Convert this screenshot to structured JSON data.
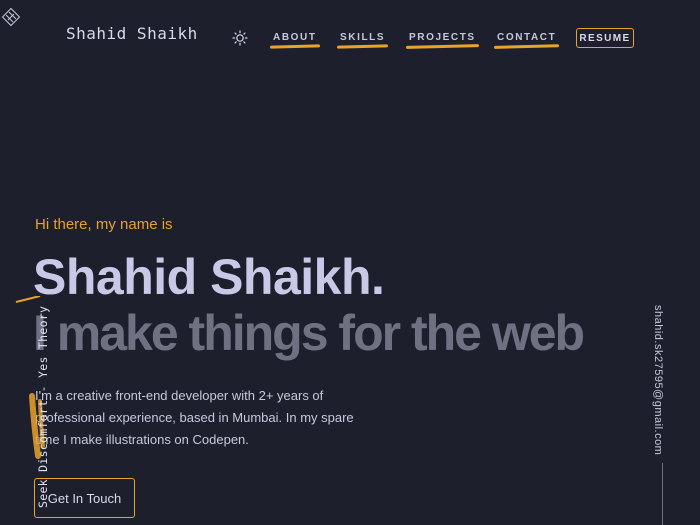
{
  "header": {
    "brand": "Shahid Shaikh",
    "nav": [
      {
        "label": "ABOUT"
      },
      {
        "label": "SKILLS"
      },
      {
        "label": "PROJECTS"
      },
      {
        "label": "CONTACT"
      }
    ],
    "resume_label": "RESUME",
    "theme_icon": "lightbulb-icon",
    "logo_icon": "diamond-logo-icon"
  },
  "hero": {
    "greeting": "Hi there, my name is",
    "name": "Shahid Shaikh.",
    "tagline": "I make things for the web",
    "bio": "I'm a creative front-end developer with 2+ years of professional experience, based in Mumbai. In my spare time I make illustrations on Codepen.",
    "cta_label": "Get In Touch"
  },
  "side": {
    "quote": "Seek Discomfort - Yes Theory",
    "email": "shahid.sk27595@gmail.com"
  },
  "colors": {
    "background": "#1e1f2d",
    "accent": "#e9a22a",
    "name_text": "#c7c9e6",
    "tagline_text": "#6f7183"
  }
}
